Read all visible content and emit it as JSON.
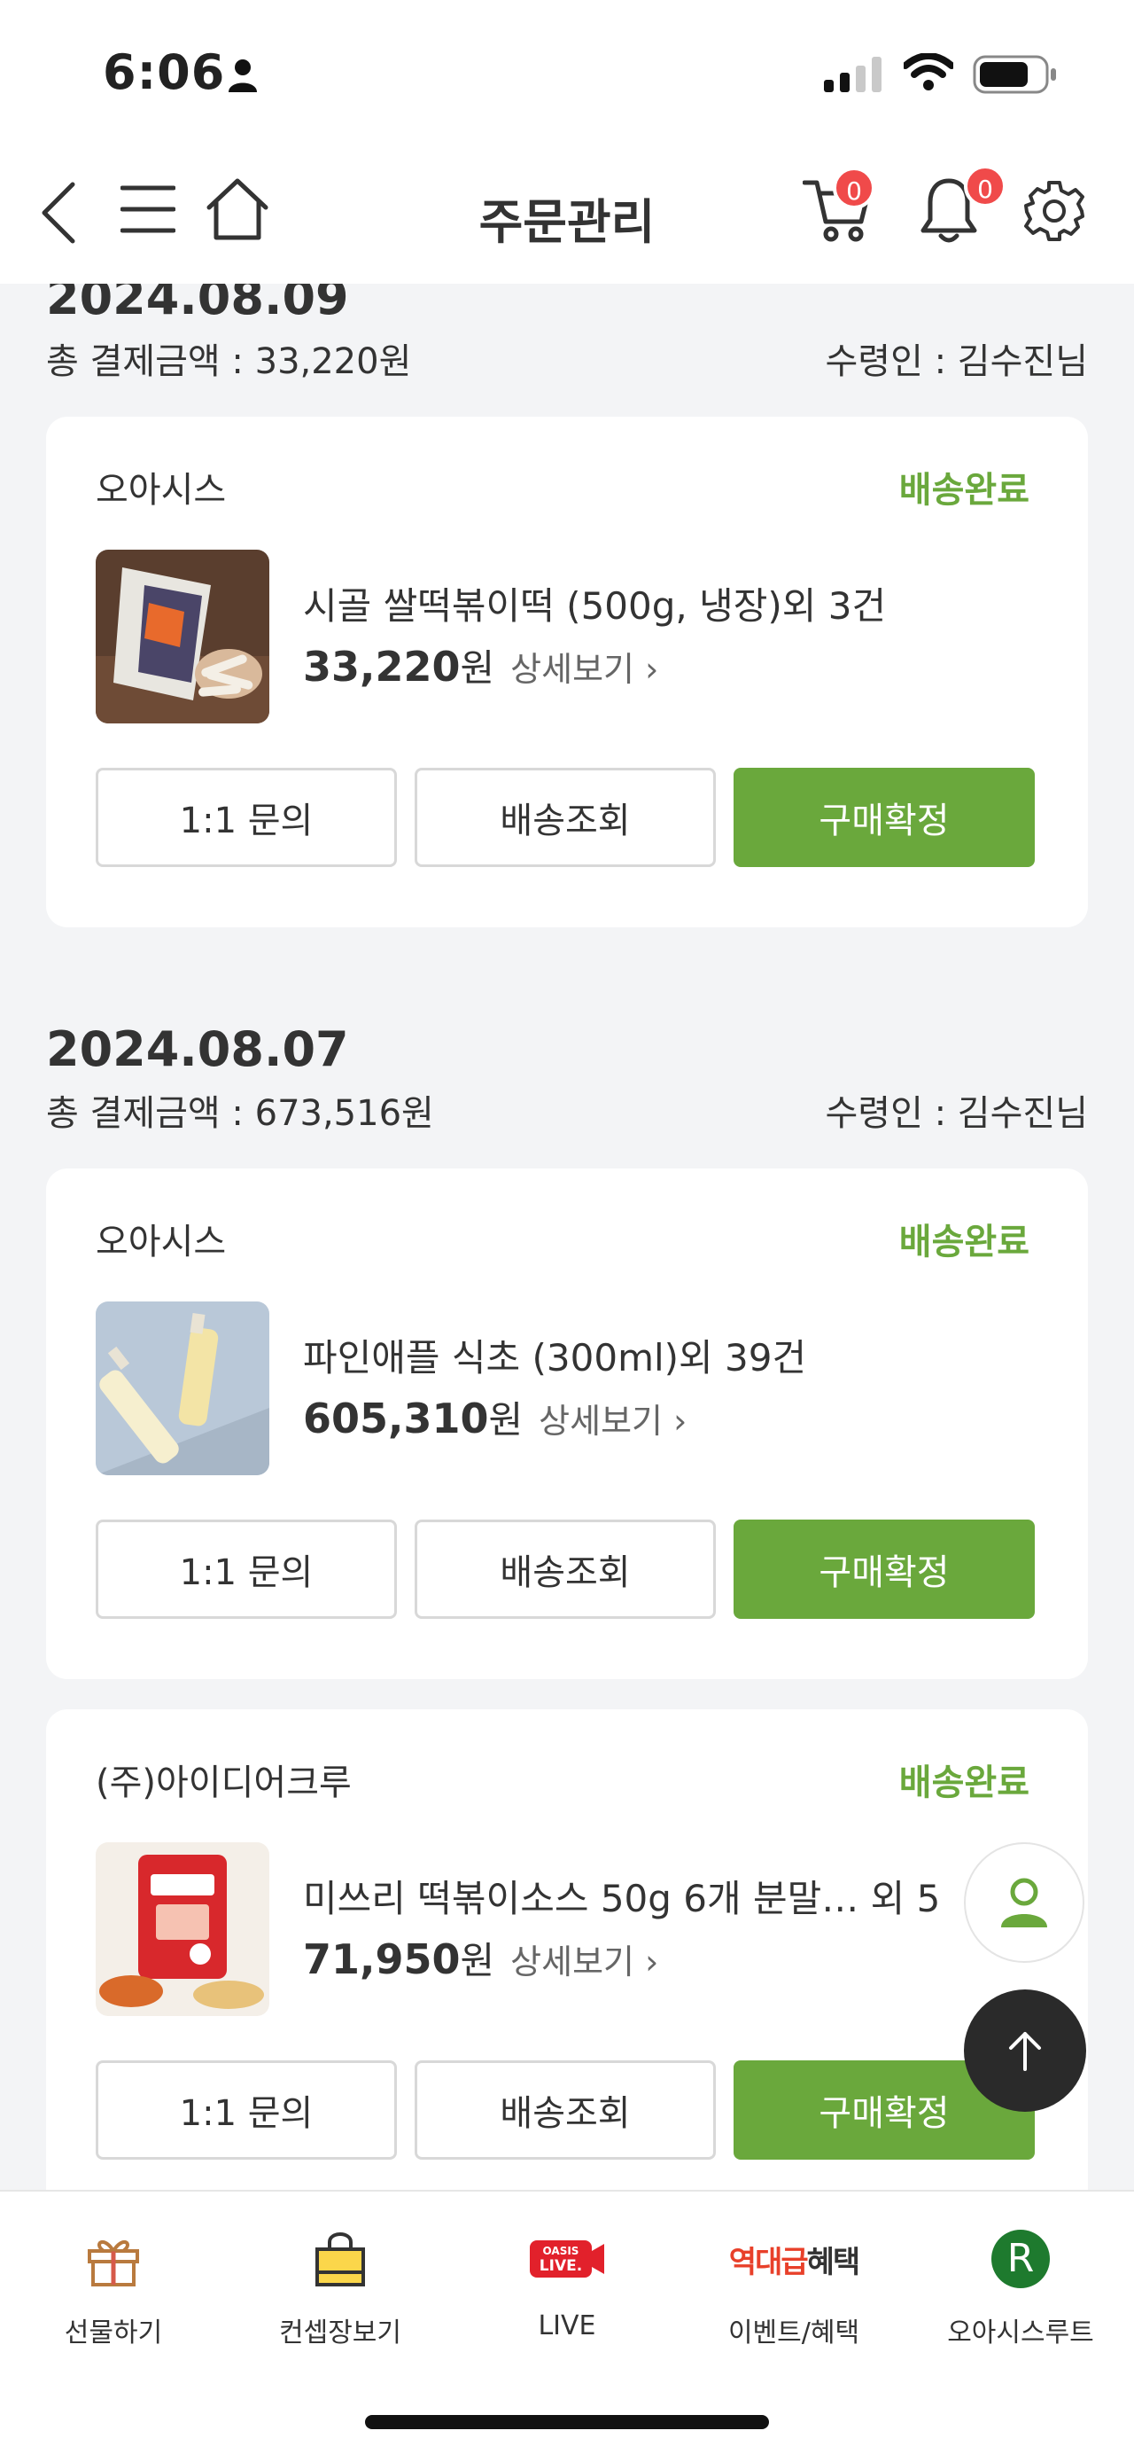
{
  "status_bar": {
    "time": "6:06"
  },
  "header": {
    "title": "주문관리",
    "cart_count": "0",
    "notification_count": "0"
  },
  "orders": [
    {
      "date": "2024.08.09",
      "total_label": "총 결제금액 : 33,220원",
      "recipient_label": "수령인 : 김수진님",
      "items": [
        {
          "seller": "오아시스",
          "status": "배송완료",
          "product": "시골 쌀떡볶이떡 (500g, 냉장)외 3건",
          "price": "33,220",
          "unit": "원",
          "detail": "상세보기 ›"
        }
      ]
    },
    {
      "date": "2024.08.07",
      "total_label": "총 결제금액 : 673,516원",
      "recipient_label": "수령인 : 김수진님",
      "items": [
        {
          "seller": "오아시스",
          "status": "배송완료",
          "product": "파인애플 식초 (300ml)외 39건",
          "price": "605,310",
          "unit": "원",
          "detail": "상세보기 ›"
        },
        {
          "seller": "(주)아이디어크루",
          "status": "배송완료",
          "product": "미쓰리 떡볶이소스 50g 6개 분말…  외 5",
          "price": "71,950",
          "unit": "원",
          "detail": "상세보기 ›"
        }
      ]
    }
  ],
  "buttons": {
    "inquiry": "1:1 문의",
    "tracking": "배송조회",
    "confirm": "구매확정"
  },
  "bottom_nav": [
    {
      "label": "선물하기",
      "icon": "gift-icon"
    },
    {
      "label": "컨셉장보기",
      "icon": "shopping-bag-icon"
    },
    {
      "label": "LIVE",
      "icon": "oasis-live-icon"
    },
    {
      "label": "이벤트/혜택",
      "icon": "event-benefit-icon",
      "icon_text_red": "역대급",
      "icon_text_dark": "혜택"
    },
    {
      "label": "오아시스루트",
      "icon": "oasis-route-icon",
      "icon_text": "R"
    }
  ],
  "live_icon_text": [
    "OASIS",
    "LIVE."
  ],
  "colors": {
    "accent": "#6aa83c",
    "badge": "#f04a4a",
    "background": "#f3f4f6"
  }
}
